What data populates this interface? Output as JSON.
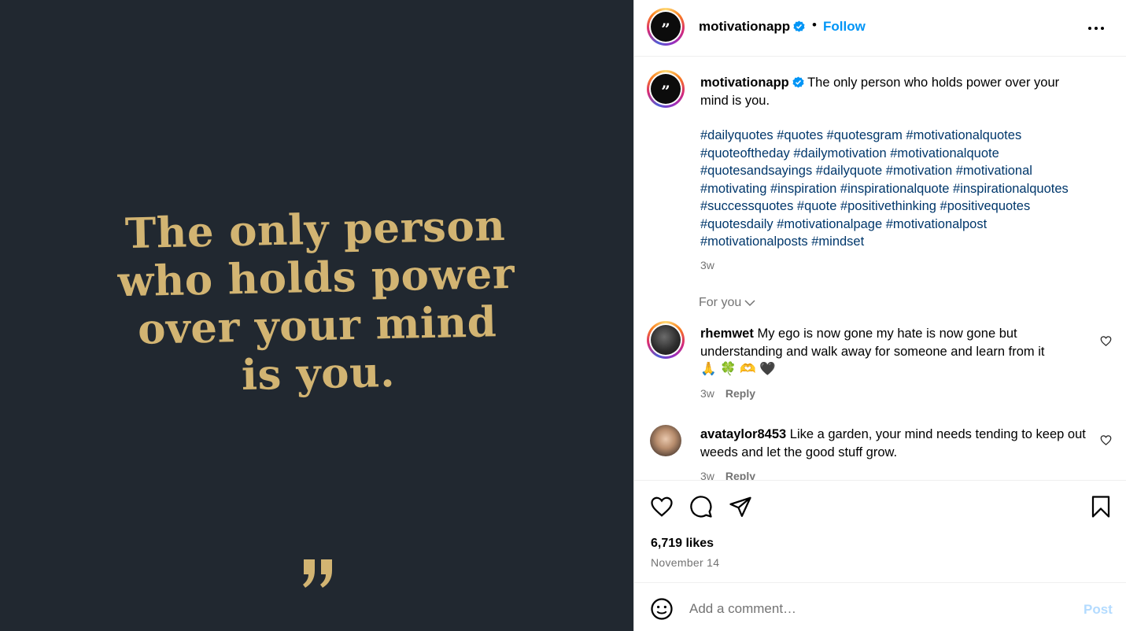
{
  "image": {
    "quote_lines": [
      "The only person",
      "who holds power",
      "over your mind",
      "is you."
    ],
    "quote_mark": "”",
    "background_color": "#212830",
    "text_color": "#d2b472"
  },
  "header": {
    "avatar_glyph": "”",
    "username": "motivationapp",
    "dot": "•",
    "follow_label": "Follow"
  },
  "caption": {
    "avatar_glyph": "”",
    "username": "motivationapp",
    "text": "The only person who holds power over your mind is you.",
    "hashtags": "#dailyquotes #quotes #quotesgram #motivationalquotes #quoteoftheday #dailymotivation #motivationalquote #quotesandsayings #dailyquote #motivation #motivational #motivating #inspiration #inspirationalquote #inspirationalquotes #successquotes #quote #positivethinking #positivequotes #quotesdaily #motivationalpage #motivationalpost #motivationalposts #mindset",
    "time": "3w"
  },
  "for_you_label": "For you",
  "comments": [
    {
      "username": "rhemwet",
      "text": "My ego is now gone my hate is now gone but understanding and walk away for someone and learn from it",
      "emojis": "🙏 🍀 🫶 🖤",
      "time": "3w",
      "reply_label": "Reply"
    },
    {
      "username": "avataylor8453",
      "text": "Like a garden, your mind needs tending to keep out weeds and let the good stuff grow.",
      "time": "3w",
      "reply_label": "Reply"
    }
  ],
  "likes_text": "6,719 likes",
  "date": "November 14",
  "comment_box": {
    "placeholder": "Add a comment…",
    "post_label": "Post"
  },
  "colors": {
    "accent": "#0095f6",
    "hashtag": "#00376b",
    "muted": "#737373",
    "post_disabled": "#b3dbff"
  }
}
